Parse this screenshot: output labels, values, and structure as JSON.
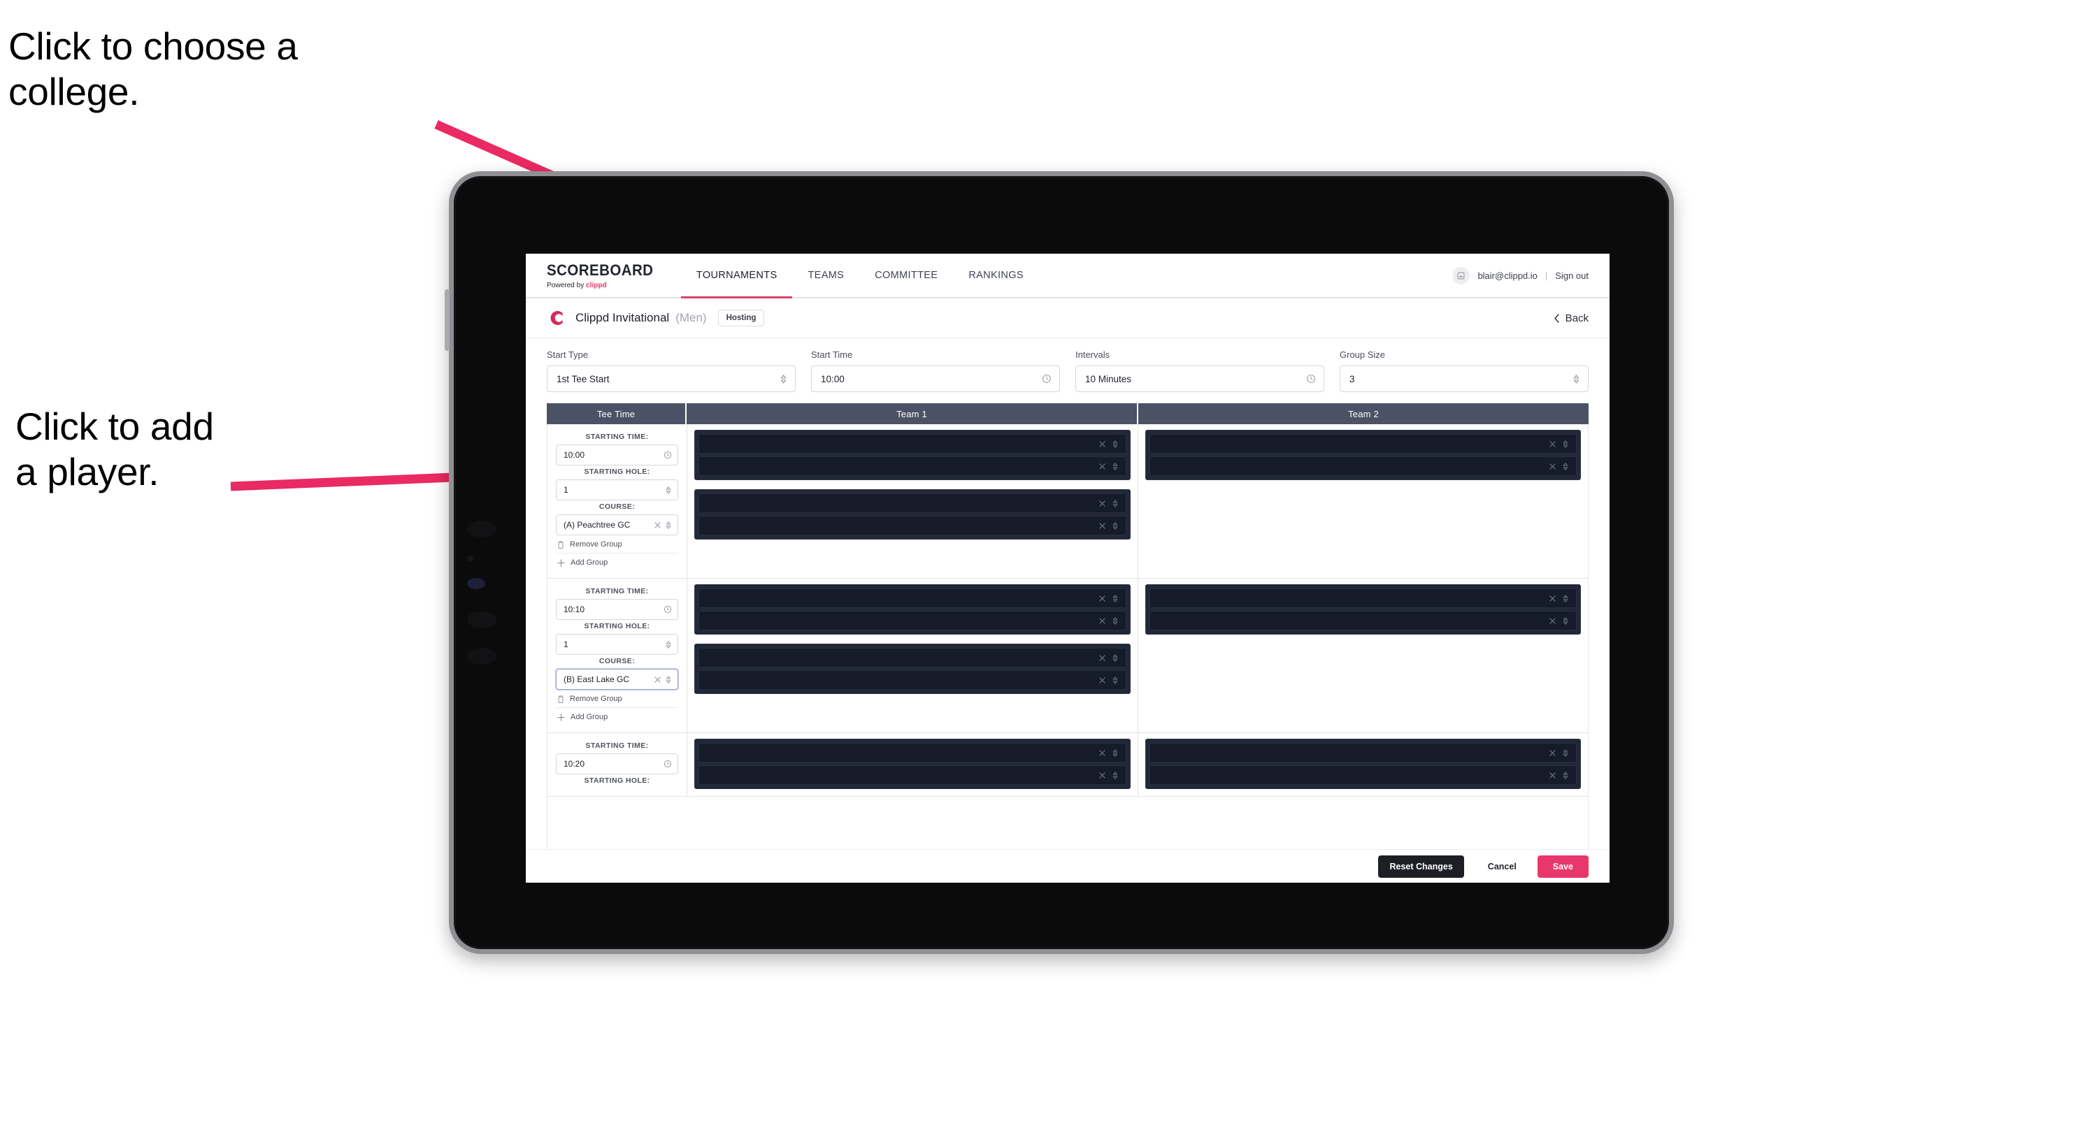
{
  "annotations": [
    {
      "id": "anno-college",
      "text": "Click to choose a\ncollege."
    },
    {
      "id": "anno-player",
      "text": "Click to add\na player."
    }
  ],
  "accent_colors": {
    "arrow_pink": "#ea2a63",
    "brand_pink": "#e8346a",
    "save_pink": "#e8376b",
    "header_slate": "#4c5265",
    "player_row_dark": "#151b28",
    "group_box_dark": "#222838"
  },
  "topbar": {
    "brand_line1": "SCOREBOARD",
    "brand_line2_prefix": "Powered by ",
    "brand_line2_accent": "clippd",
    "nav": [
      {
        "label": "TOURNAMENTS",
        "active": true
      },
      {
        "label": "TEAMS",
        "active": false
      },
      {
        "label": "COMMITTEE",
        "active": false
      },
      {
        "label": "RANKINGS",
        "active": false
      }
    ],
    "avatar_icon": "user-avatar-icon",
    "user_email": "blair@clippd.io",
    "separator": "|",
    "sign_out": "Sign out"
  },
  "titlebar": {
    "logo_letter": "C",
    "tournament_name": "Clippd Invitational",
    "gender": "(Men)",
    "badge": "Hosting",
    "back_label": "Back",
    "back_icon": "chevron-left-icon"
  },
  "filters": [
    {
      "label": "Start Type",
      "value": "1st Tee Start",
      "icon": "stepper-icon"
    },
    {
      "label": "Start Time",
      "value": "10:00",
      "icon": "clock-icon"
    },
    {
      "label": "Intervals",
      "value": "10 Minutes",
      "icon": "clock-icon"
    },
    {
      "label": "Group Size",
      "value": "3",
      "icon": "stepper-icon"
    }
  ],
  "table": {
    "headers": [
      "Tee Time",
      "Team 1",
      "Team 2"
    ],
    "labels": {
      "starting_time": "STARTING TIME:",
      "starting_hole": "STARTING HOLE:",
      "course": "COURSE:",
      "remove_group": "Remove Group",
      "add_group": "Add Group",
      "remove_icon": "trash-icon",
      "add_icon": "plus-icon",
      "clear_icon": "clear-x-icon",
      "chevron_icon": "chevron-updown-icon"
    },
    "rows": [
      {
        "starting_time": "10:00",
        "starting_hole": "1",
        "course": "(A) Peachtree GC",
        "course_focused": false,
        "teams": [
          {
            "groups": [
              {
                "players": [
                  "",
                  ""
                ]
              },
              {
                "players": [
                  "",
                  ""
                ]
              }
            ]
          },
          {
            "groups": [
              {
                "players": [
                  "",
                  ""
                ]
              }
            ]
          }
        ]
      },
      {
        "starting_time": "10:10",
        "starting_hole": "1",
        "course": "(B) East Lake GC",
        "course_focused": true,
        "teams": [
          {
            "groups": [
              {
                "players": [
                  "",
                  ""
                ]
              },
              {
                "players": [
                  "",
                  ""
                ]
              }
            ]
          },
          {
            "groups": [
              {
                "players": [
                  "",
                  ""
                ]
              }
            ]
          }
        ]
      },
      {
        "starting_time": "10:20",
        "starting_hole": "",
        "course": "",
        "course_focused": false,
        "teams": [
          {
            "groups": [
              {
                "players": [
                  "",
                  ""
                ]
              }
            ]
          },
          {
            "groups": [
              {
                "players": [
                  "",
                  ""
                ]
              }
            ]
          }
        ]
      }
    ]
  },
  "footer": {
    "reset": "Reset Changes",
    "cancel": "Cancel",
    "save": "Save"
  }
}
